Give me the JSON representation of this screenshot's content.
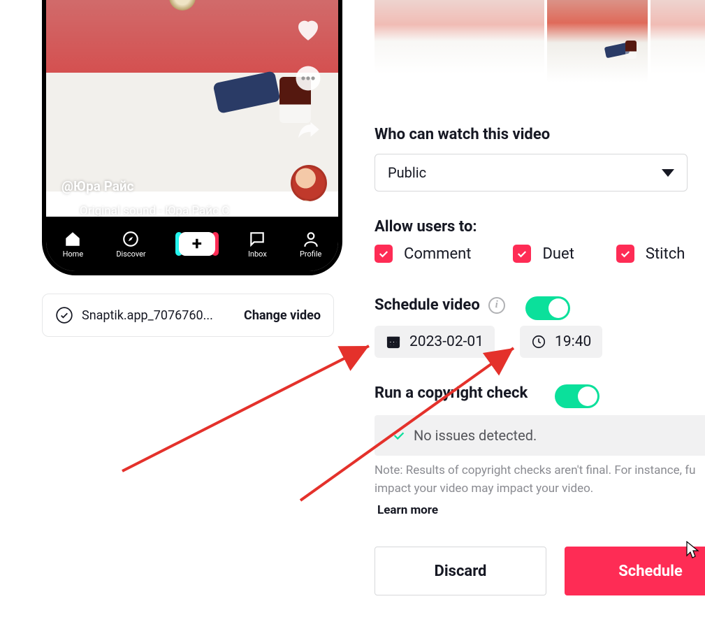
{
  "phonePreview": {
    "captionHandle": "@Юра Райс",
    "soundText": "Original sound - Юра Райс С",
    "nav": {
      "home": "Home",
      "discover": "Discover",
      "inbox": "Inbox",
      "profile": "Profile"
    }
  },
  "fileRow": {
    "filename": "Snaptik.app_7076760...",
    "changeLabel": "Change video"
  },
  "privacy": {
    "heading": "Who can watch this video",
    "selected": "Public"
  },
  "allow": {
    "heading": "Allow users to:",
    "comment": "Comment",
    "duet": "Duet",
    "stitch": "Stitch"
  },
  "schedule": {
    "heading": "Schedule video",
    "date": "2023-02-01",
    "time": "19:40"
  },
  "copyright": {
    "heading": "Run a copyright check",
    "status": "No issues detected.",
    "note": "Note: Results of copyright checks aren't final. For instance, fu impact your video may impact your video.",
    "learnMore": "Learn more"
  },
  "buttons": {
    "discard": "Discard",
    "schedule": "Schedule"
  }
}
